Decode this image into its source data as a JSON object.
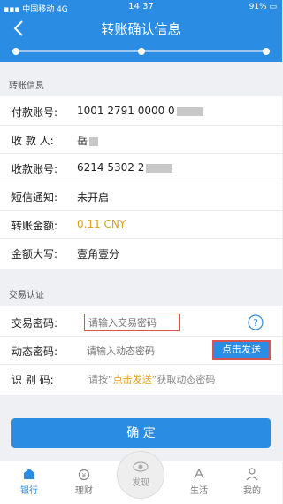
{
  "status_bar": {
    "carrier": "中国移动",
    "network": "4G",
    "time": "14:37",
    "battery": "91%"
  },
  "header": {
    "title": "转账确认信息"
  },
  "transfer_info": {
    "section_label": "转账信息",
    "rows": [
      {
        "label": "付款账号:",
        "value": "1001 2791 0000 0"
      },
      {
        "label": "收 款 人:",
        "value": "岳"
      },
      {
        "label": "收款账号:",
        "value": "6214 5302 2"
      },
      {
        "label": "短信通知:",
        "value": "未开启"
      },
      {
        "label": "转账金额:",
        "value": "0.11 CNY"
      },
      {
        "label": "金额大写:",
        "value": "壹角壹分"
      }
    ]
  },
  "auth": {
    "section_label": "交易认证",
    "password_label": "交易密码:",
    "password_placeholder": "请输入交易密码",
    "dynamic_label": "动态密码:",
    "dynamic_placeholder": "请输入动态密码",
    "send_label": "点击发送",
    "code_label": "识 别 码:",
    "code_hint_prefix": "请按“",
    "code_hint_highlight": "点击发送",
    "code_hint_suffix": "”获取动态密码"
  },
  "confirm_label": "确 定",
  "tabs": {
    "bank": "银行",
    "finance": "理财",
    "discover": "发现",
    "life": "生活",
    "mine": "我的"
  },
  "colors": {
    "primary": "#2a8de3",
    "amount": "#d9a31a",
    "error_border": "#d9534f"
  }
}
